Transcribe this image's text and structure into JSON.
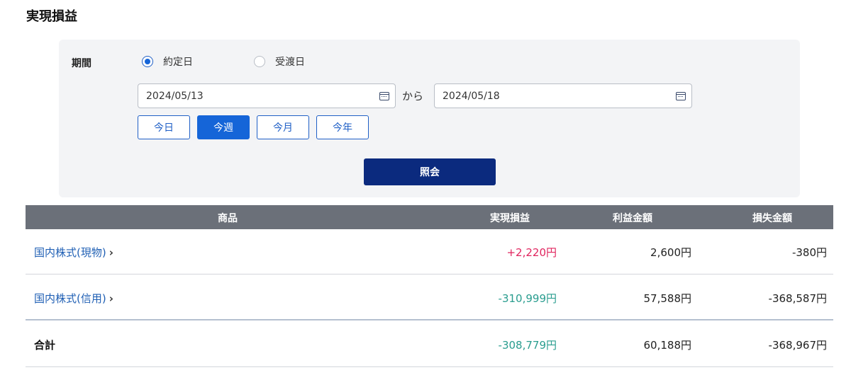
{
  "page": {
    "title": "実現損益"
  },
  "filter": {
    "period_label": "期間",
    "radio_options": [
      {
        "label": "約定日",
        "checked": true
      },
      {
        "label": "受渡日",
        "checked": false
      }
    ],
    "date_from": "2024/05/13",
    "date_to": "2024/05/18",
    "range_connector": "から",
    "quick_buttons": [
      {
        "label": "今日",
        "active": false
      },
      {
        "label": "今週",
        "active": true
      },
      {
        "label": "今月",
        "active": false
      },
      {
        "label": "今年",
        "active": false
      }
    ],
    "submit_label": "照会"
  },
  "table": {
    "headers": [
      "商品",
      "実現損益",
      "利益金額",
      "損失金額"
    ],
    "rows": [
      {
        "product": "国内株式(現物)",
        "pl": "+2,220円",
        "profit": "2,600円",
        "loss": "-380円"
      },
      {
        "product": "国内株式(信用)",
        "pl": "-310,999円",
        "profit": "57,588円",
        "loss": "-368,587円"
      }
    ],
    "total": {
      "label": "合計",
      "pl": "-308,779円",
      "profit": "60,188円",
      "loss": "-368,967円"
    }
  },
  "colors": {
    "positive": "#e0245e",
    "negative": "#2a9d8f",
    "primary": "#1565d8",
    "submit": "#0b2a7e",
    "header_bg": "#6b7079"
  }
}
